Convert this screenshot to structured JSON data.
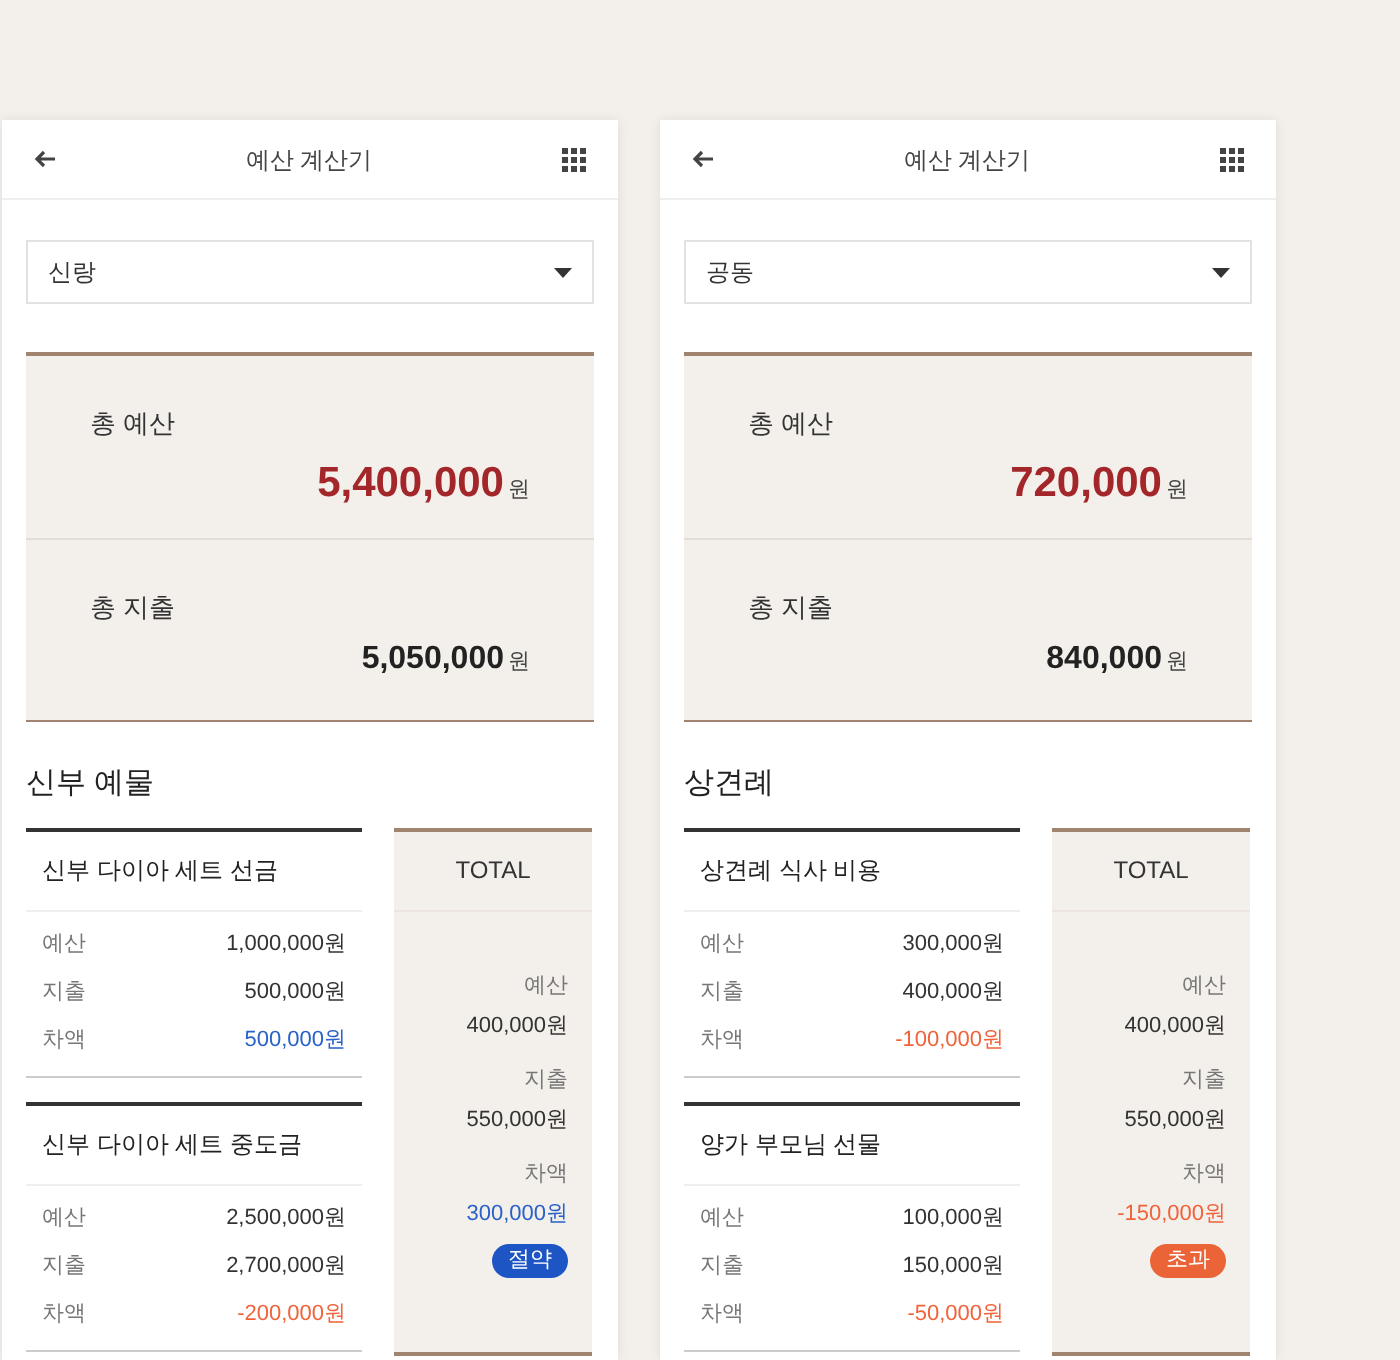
{
  "screens": [
    {
      "header": {
        "title": "예산 계산기"
      },
      "dropdown": {
        "value": "신랑"
      },
      "summary": [
        {
          "label": "총 예산",
          "amount": "5,400,000",
          "unit": "원",
          "kind": "budget"
        },
        {
          "label": "총 지출",
          "amount": "5,050,000",
          "unit": "원",
          "kind": "spent"
        }
      ],
      "section": {
        "title": "신부 예물",
        "items": [
          {
            "name": "신부 다이아 세트 선금",
            "rows": [
              {
                "label": "예산",
                "value": "1,000,000원",
                "kind": "plain"
              },
              {
                "label": "지출",
                "value": "500,000원",
                "kind": "plain"
              },
              {
                "label": "차액",
                "value": "500,000원",
                "kind": "under"
              }
            ]
          },
          {
            "name": "신부 다이아 세트 중도금",
            "rows": [
              {
                "label": "예산",
                "value": "2,500,000원",
                "kind": "plain"
              },
              {
                "label": "지출",
                "value": "2,700,000원",
                "kind": "plain"
              },
              {
                "label": "차액",
                "value": "-200,000원",
                "kind": "over"
              }
            ]
          }
        ],
        "total": {
          "heading": "TOTAL",
          "rows": [
            {
              "label": "예산",
              "value": "400,000원",
              "kind": "plain"
            },
            {
              "label": "지출",
              "value": "550,000원",
              "kind": "plain"
            },
            {
              "label": "차액",
              "value": "300,000원",
              "kind": "under"
            }
          ],
          "badge": {
            "text": "절약",
            "kind": "under"
          }
        }
      }
    },
    {
      "header": {
        "title": "예산 계산기"
      },
      "dropdown": {
        "value": "공동"
      },
      "summary": [
        {
          "label": "총 예산",
          "amount": "720,000",
          "unit": "원",
          "kind": "budget"
        },
        {
          "label": "총 지출",
          "amount": "840,000",
          "unit": "원",
          "kind": "spent"
        }
      ],
      "section": {
        "title": "상견례",
        "items": [
          {
            "name": "상견례 식사 비용",
            "rows": [
              {
                "label": "예산",
                "value": "300,000원",
                "kind": "plain"
              },
              {
                "label": "지출",
                "value": "400,000원",
                "kind": "plain"
              },
              {
                "label": "차액",
                "value": "-100,000원",
                "kind": "over"
              }
            ]
          },
          {
            "name": "양가 부모님 선물",
            "rows": [
              {
                "label": "예산",
                "value": "100,000원",
                "kind": "plain"
              },
              {
                "label": "지출",
                "value": "150,000원",
                "kind": "plain"
              },
              {
                "label": "차액",
                "value": "-50,000원",
                "kind": "over"
              }
            ]
          }
        ],
        "total": {
          "heading": "TOTAL",
          "rows": [
            {
              "label": "예산",
              "value": "400,000원",
              "kind": "plain"
            },
            {
              "label": "지출",
              "value": "550,000원",
              "kind": "plain"
            },
            {
              "label": "차액",
              "value": "-150,000원",
              "kind": "over"
            }
          ],
          "badge": {
            "text": "초과",
            "kind": "over"
          }
        }
      }
    }
  ]
}
